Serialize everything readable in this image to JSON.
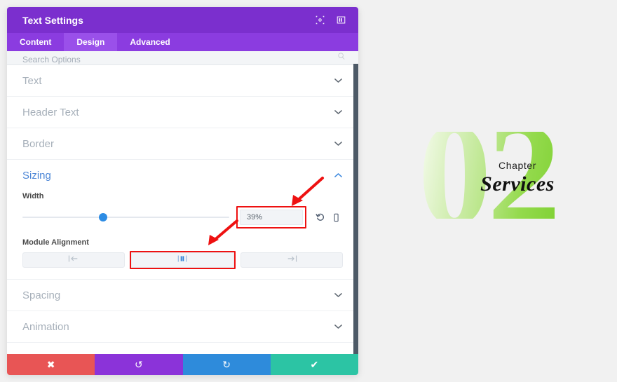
{
  "window": {
    "title": "Text Settings",
    "header_icons": [
      {
        "name": "target-icon",
        "glyph": "⌖"
      },
      {
        "name": "layout-columns-icon",
        "glyph": "▥"
      }
    ]
  },
  "tabs": [
    {
      "label": "Content",
      "active": false
    },
    {
      "label": "Design",
      "active": true
    },
    {
      "label": "Advanced",
      "active": false
    }
  ],
  "search": {
    "placeholder": "Search Options",
    "icon": "search-icon"
  },
  "sections": [
    {
      "label": "Text",
      "open": false,
      "chevron": "chevron-down-icon"
    },
    {
      "label": "Header Text",
      "open": false,
      "chevron": "chevron-down-icon"
    },
    {
      "label": "Border",
      "open": false,
      "chevron": "chevron-down-icon"
    },
    {
      "label": "Sizing",
      "open": true,
      "chevron": "chevron-up-icon"
    },
    {
      "label": "Spacing",
      "open": false,
      "chevron": "chevron-down-icon"
    },
    {
      "label": "Animation",
      "open": false,
      "chevron": "chevron-down-icon"
    }
  ],
  "sizing": {
    "width": {
      "label": "Width",
      "value": "39%",
      "slider_percent": 39,
      "reset_icon": "reset-icon",
      "responsive_icon": "mobile-device-icon",
      "highlighted": true
    },
    "module_alignment": {
      "label": "Module Alignment",
      "options": [
        {
          "name": "align-left",
          "icon": "align-left-icon",
          "selected": false,
          "highlighted": false
        },
        {
          "name": "align-center",
          "icon": "align-center-icon",
          "selected": true,
          "highlighted": true
        },
        {
          "name": "align-right",
          "icon": "align-right-icon",
          "selected": false,
          "highlighted": false
        }
      ]
    }
  },
  "footer": [
    {
      "name": "cancel-button",
      "glyph": "✖",
      "color": "#e85555"
    },
    {
      "name": "undo-button",
      "glyph": "↺",
      "color": "#8b33d9"
    },
    {
      "name": "redo-button",
      "glyph": "↻",
      "color": "#2e8bdb"
    },
    {
      "name": "save-button",
      "glyph": "✔",
      "color": "#2cc4a4"
    }
  ],
  "annotations": {
    "color": "#ee1111",
    "arrows": [
      {
        "name": "arrow-to-width-field"
      },
      {
        "name": "arrow-to-center-align-button"
      }
    ]
  },
  "page_content": {
    "number": "02",
    "chapter_label": "Chapter",
    "chapter_title": "Services",
    "accent_color": "#7fd133"
  }
}
